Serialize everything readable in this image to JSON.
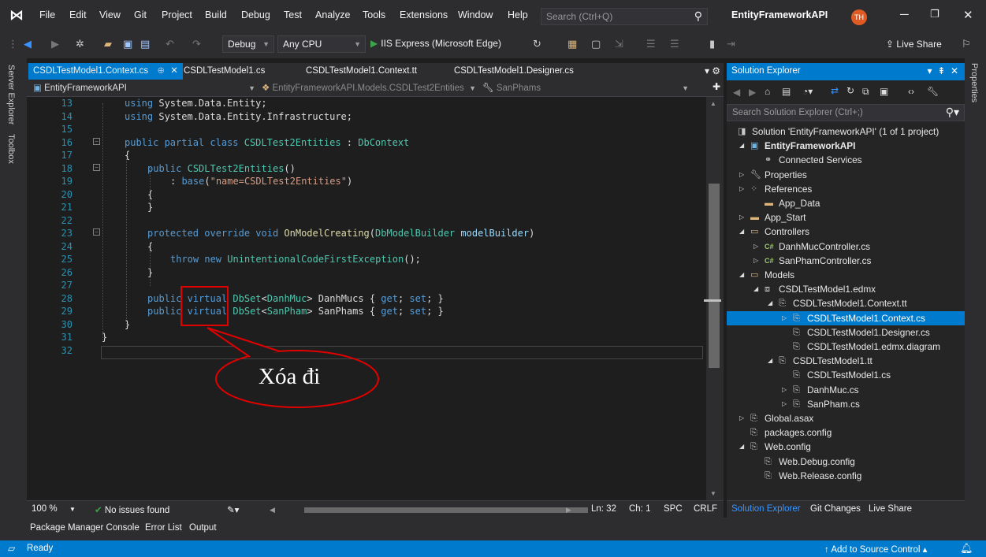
{
  "menu": {
    "items": [
      "File",
      "Edit",
      "View",
      "Git",
      "Project",
      "Build",
      "Debug",
      "Test",
      "Analyze",
      "Tools",
      "Extensions",
      "Window",
      "Help"
    ],
    "search_placeholder": "Search (Ctrl+Q)",
    "solution_name": "EntityFrameworkAPI",
    "avatar_initials": "TH"
  },
  "toolbar": {
    "config": "Debug",
    "platform": "Any CPU",
    "run_label": "IIS Express (Microsoft Edge)",
    "live_share": "Live Share"
  },
  "side_tabs": [
    "Server Explorer",
    "Toolbox"
  ],
  "right_tabs": [
    "Properties"
  ],
  "doc_tabs": [
    {
      "label": "CSDLTestModel1.Context.cs",
      "active": true
    },
    {
      "label": "CSDLTestModel1.cs",
      "active": false
    },
    {
      "label": "CSDLTestModel1.Context.tt",
      "active": false
    },
    {
      "label": "CSDLTestModel1.Designer.cs",
      "active": false
    }
  ],
  "navbar": {
    "project": "EntityFrameworkAPI",
    "class": "EntityFrameworkAPI.Models.CSDLTest2Entities",
    "member": "SanPhams"
  },
  "code_lines": [
    {
      "n": "13",
      "text": "using System.Data.Entity;"
    },
    {
      "n": "14",
      "text": "using System.Data.Entity.Infrastructure;"
    },
    {
      "n": "15",
      "text": ""
    },
    {
      "n": "16",
      "text": "public partial class CSDLTest2Entities : DbContext"
    },
    {
      "n": "17",
      "text": "{"
    },
    {
      "n": "18",
      "text": "public CSDLTest2Entities()"
    },
    {
      "n": "19",
      "text": ": base(\"name=CSDLTest2Entities\")"
    },
    {
      "n": "20",
      "text": "{"
    },
    {
      "n": "21",
      "text": "}"
    },
    {
      "n": "22",
      "text": ""
    },
    {
      "n": "23",
      "text": "protected override void OnModelCreating(DbModelBuilder modelBuilder)"
    },
    {
      "n": "24",
      "text": "{"
    },
    {
      "n": "25",
      "text": "throw new UnintentionalCodeFirstException();"
    },
    {
      "n": "26",
      "text": "}"
    },
    {
      "n": "27",
      "text": ""
    },
    {
      "n": "28",
      "text": "public virtual DbSet<DanhMuc> DanhMucs { get; set; }"
    },
    {
      "n": "29",
      "text": "public virtual DbSet<SanPham> SanPhams { get; set; }"
    },
    {
      "n": "30",
      "text": "}"
    },
    {
      "n": "31",
      "text": "}"
    },
    {
      "n": "32",
      "text": ""
    }
  ],
  "annotation": {
    "text": "Xóa đi",
    "color": "#e00000"
  },
  "editor_status": {
    "zoom": "100 %",
    "issues": "No issues found",
    "ln": "Ln: 32",
    "ch": "Ch: 1",
    "spc": "SPC",
    "eol": "CRLF"
  },
  "bottom_tabs": [
    "Package Manager Console",
    "Error List",
    "Output"
  ],
  "solution_explorer": {
    "title": "Solution Explorer",
    "search_placeholder": "Search Solution Explorer (Ctrl+;)",
    "tree": [
      {
        "label": "Solution 'EntityFrameworkAPI' (1 of 1 project)",
        "icon": "solution-icon",
        "exp": ""
      },
      {
        "label": "EntityFrameworkAPI",
        "icon": "project-icon",
        "exp": "expanded"
      },
      {
        "label": "Connected Services",
        "icon": "connected-services-icon",
        "exp": ""
      },
      {
        "label": "Properties",
        "icon": "wrench-icon",
        "exp": "collapsed"
      },
      {
        "label": "References",
        "icon": "references-icon",
        "exp": "collapsed"
      },
      {
        "label": "App_Data",
        "icon": "folder-icon",
        "exp": ""
      },
      {
        "label": "App_Start",
        "icon": "folder-icon",
        "exp": "collapsed"
      },
      {
        "label": "Controllers",
        "icon": "folder-open-icon",
        "exp": "expanded"
      },
      {
        "label": "DanhMucController.cs",
        "icon": "csharp-file-icon",
        "exp": "collapsed"
      },
      {
        "label": "SanPhamController.cs",
        "icon": "csharp-file-icon",
        "exp": "collapsed"
      },
      {
        "label": "Models",
        "icon": "folder-open-icon",
        "exp": "expanded"
      },
      {
        "label": "CSDLTestModel1.edmx",
        "icon": "edmx-icon",
        "exp": "expanded"
      },
      {
        "label": "CSDLTestModel1.Context.tt",
        "icon": "tt-file-icon",
        "exp": "expanded"
      },
      {
        "label": "CSDLTestModel1.Context.cs",
        "icon": "tt-file-icon",
        "exp": "collapsed",
        "selected": true
      },
      {
        "label": "CSDLTestModel1.Designer.cs",
        "icon": "tt-file-icon",
        "exp": ""
      },
      {
        "label": "CSDLTestModel1.edmx.diagram",
        "icon": "tt-file-icon",
        "exp": ""
      },
      {
        "label": "CSDLTestModel1.tt",
        "icon": "tt-file-icon",
        "exp": "expanded"
      },
      {
        "label": "CSDLTestModel1.cs",
        "icon": "tt-file-icon",
        "exp": ""
      },
      {
        "label": "DanhMuc.cs",
        "icon": "tt-file-icon",
        "exp": "collapsed"
      },
      {
        "label": "SanPham.cs",
        "icon": "tt-file-icon",
        "exp": "collapsed"
      },
      {
        "label": "Global.asax",
        "icon": "global-asax-icon",
        "exp": "collapsed"
      },
      {
        "label": "packages.config",
        "icon": "config-file-icon",
        "exp": ""
      },
      {
        "label": "Web.config",
        "icon": "config-file-icon",
        "exp": "expanded"
      },
      {
        "label": "Web.Debug.config",
        "icon": "tt-file-icon",
        "exp": ""
      },
      {
        "label": "Web.Release.config",
        "icon": "tt-file-icon",
        "exp": ""
      }
    ],
    "tabs": [
      "Solution Explorer",
      "Git Changes",
      "Live Share"
    ]
  },
  "statusbar": {
    "ready": "Ready",
    "source_control": "Add to Source Control"
  },
  "colors": {
    "accent": "#007acc",
    "annotation": "#e00000"
  }
}
